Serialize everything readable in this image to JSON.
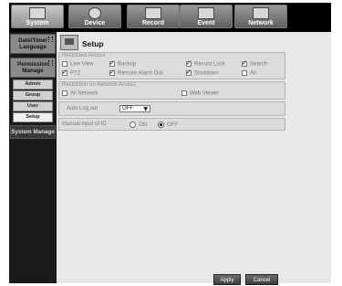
{
  "tabs": [
    {
      "label": "System",
      "icon": "system-icon"
    },
    {
      "label": "Device",
      "icon": "camera-icon"
    },
    {
      "label": "Record",
      "icon": "record-icon"
    },
    {
      "label": "Event",
      "icon": "event-icon"
    },
    {
      "label": "Network",
      "icon": "network-icon"
    }
  ],
  "sidebar": {
    "date_time_language": "Date/Time/ Language",
    "permission_manage": "Permission Manage",
    "sub_items": [
      "Admin",
      "Group",
      "User",
      "Setup"
    ],
    "system_manage": "System Manage"
  },
  "page": {
    "title": "Setup"
  },
  "restricted_access": {
    "header": "Restricted Access",
    "items": [
      {
        "label": "Live View",
        "checked": false
      },
      {
        "label": "Backup",
        "checked": true
      },
      {
        "label": "Record Lock",
        "checked": true
      },
      {
        "label": "Search",
        "checked": true
      },
      {
        "label": "PTZ",
        "checked": true
      },
      {
        "label": "Remote Alarm Out",
        "checked": true
      },
      {
        "label": "Shutdown",
        "checked": true
      },
      {
        "label": "All",
        "checked": false
      }
    ]
  },
  "network_access": {
    "header": "Restriction on Network Access",
    "items": [
      {
        "label": "All Network",
        "checked": false
      },
      {
        "label": "Web Viewer",
        "checked": false
      }
    ]
  },
  "auto_log_out": {
    "label": "Auto Log out",
    "value": "OFF"
  },
  "manual_input_id": {
    "label": "Manual input of ID",
    "on_label": "ON",
    "off_label": "OFF",
    "selected": "OFF"
  },
  "buttons": {
    "apply": "Apply",
    "cancel": "Cancel"
  },
  "colors": {
    "frame": "#000000",
    "content_bg": "#e8e8e8",
    "tab_bg": "#7a7a7a"
  }
}
